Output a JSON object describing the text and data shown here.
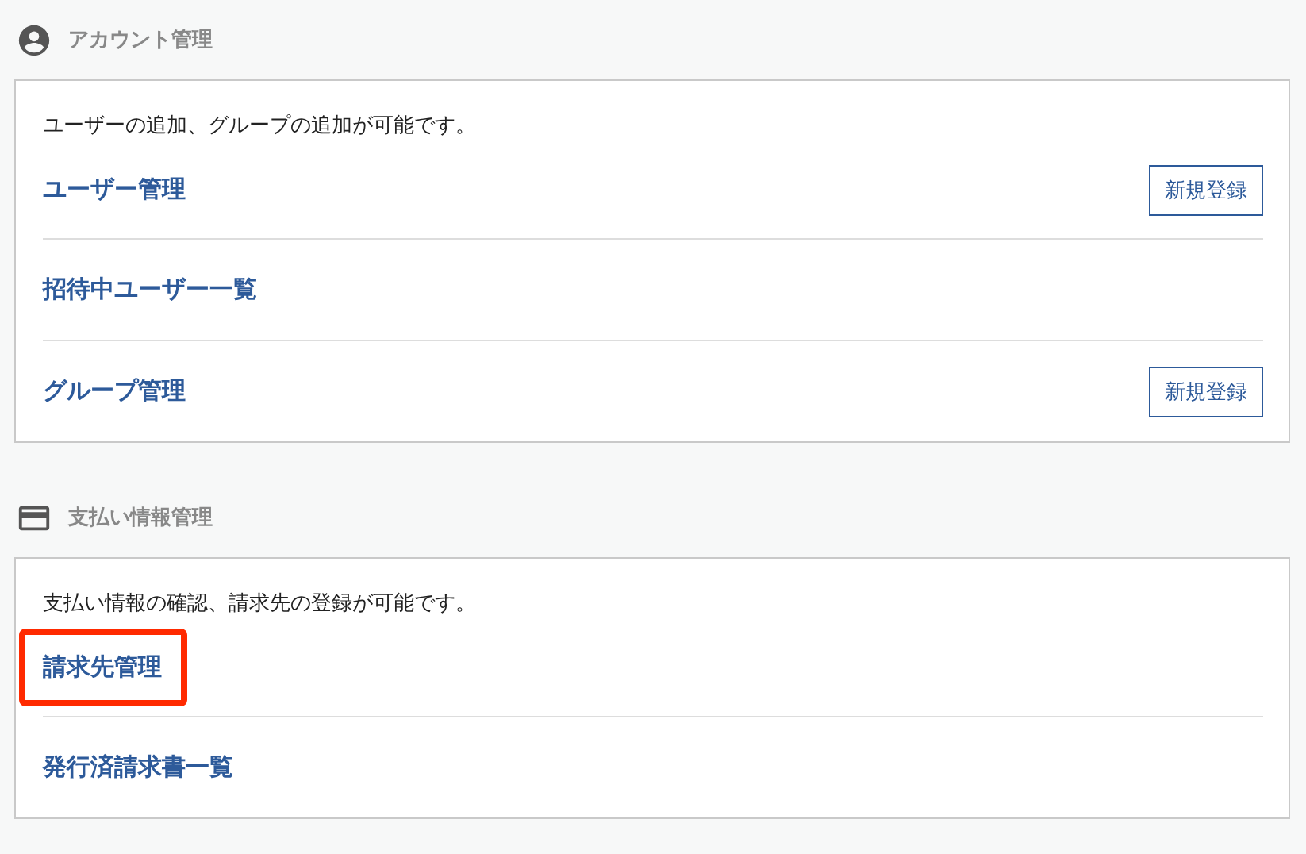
{
  "sections": [
    {
      "kind": "account",
      "title": "アカウント管理",
      "description": "ユーザーの追加、グループの追加が可能です。",
      "items": [
        {
          "label": "ユーザー管理",
          "button": "新規登録",
          "highlighted": false
        },
        {
          "label": "招待中ユーザー一覧",
          "highlighted": false
        },
        {
          "label": "グループ管理",
          "button": "新規登録",
          "highlighted": false
        }
      ]
    },
    {
      "kind": "card",
      "title": "支払い情報管理",
      "description": "支払い情報の確認、請求先の登録が可能です。",
      "items": [
        {
          "label": "請求先管理",
          "highlighted": true
        },
        {
          "label": "発行済請求書一覧",
          "highlighted": false
        }
      ]
    }
  ]
}
